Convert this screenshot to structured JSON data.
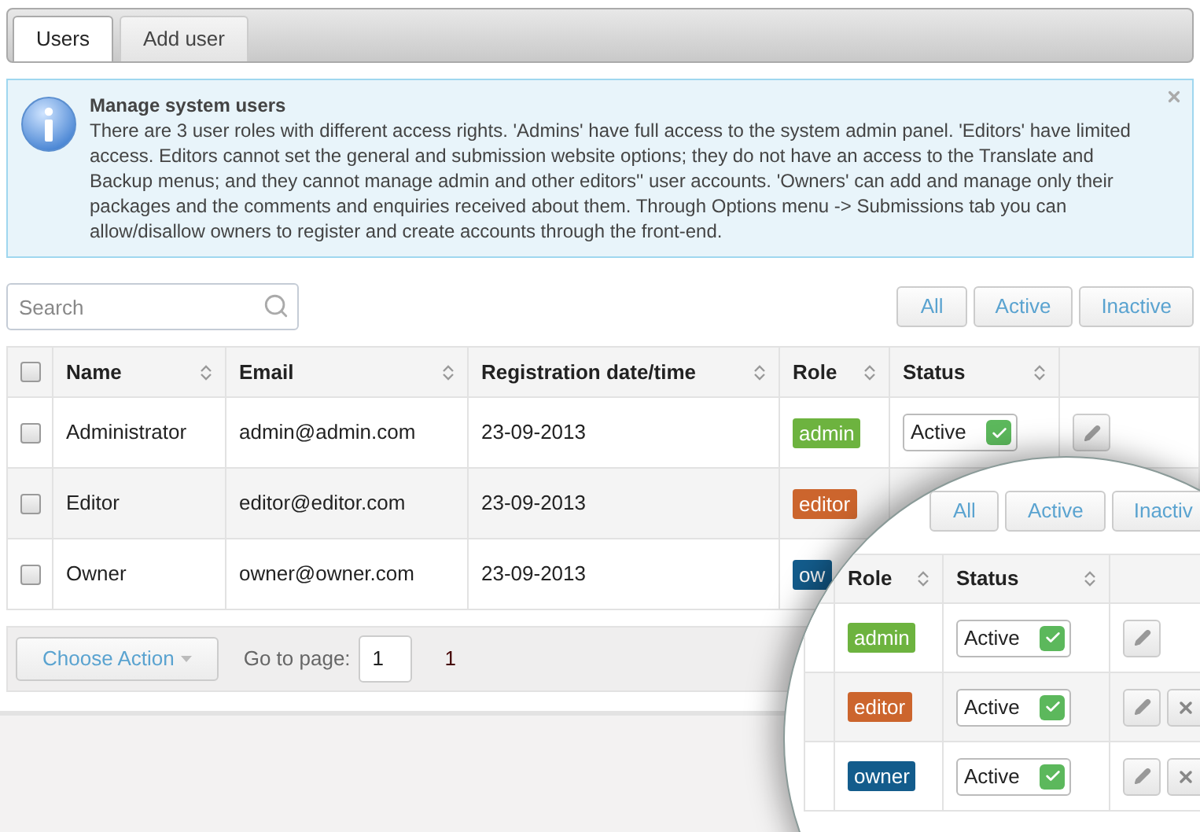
{
  "tabs": [
    {
      "label": "Users",
      "selected": true
    },
    {
      "label": "Add user",
      "selected": false
    }
  ],
  "notice": {
    "title": "Manage system users",
    "body": "There are 3 user roles with different access rights. 'Admins' have full access to the system admin panel. 'Editors' have limited access. Editors cannot set the general and submission website options; they do not have an access to the Translate and Backup menus; and they cannot manage admin and other editors'' user accounts. 'Owners' can add and manage only their packages and the comments and enquiries received about them. Through Options menu -> Submissions tab you can allow/disallow owners to register and create accounts through the front-end."
  },
  "search": {
    "placeholder": "Search"
  },
  "filters": [
    {
      "label": "All"
    },
    {
      "label": "Active"
    },
    {
      "label": "Inactive"
    }
  ],
  "table": {
    "select_all_checked": false,
    "columns": [
      "Name",
      "Email",
      "Registration date/time",
      "Role",
      "Status"
    ],
    "rows": [
      {
        "checked": false,
        "name": "Administrator",
        "email": "admin@admin.com",
        "date": "23-09-2013",
        "role": {
          "label": "admin",
          "color": "#6db33f"
        },
        "status": "Active",
        "actions": [
          {
            "kind": "edit"
          }
        ]
      },
      {
        "checked": false,
        "name": "Editor",
        "email": "editor@editor.com",
        "date": "23-09-2013",
        "role": {
          "label": "editor",
          "color": "#cc652d"
        }
      },
      {
        "checked": false,
        "name": "Owner",
        "email": "owner@owner.com",
        "date": "23-09-2013",
        "role": {
          "label": "ow",
          "color": "#135c8c"
        }
      }
    ]
  },
  "footer": {
    "bulk_action": "Choose Action",
    "go_to_label": "Go to page:",
    "go_to_value": "1",
    "current_page": "1"
  },
  "magnifier": {
    "filters": [
      {
        "label": "All"
      },
      {
        "label": "Active"
      },
      {
        "label": "Inactiv"
      }
    ],
    "columns": [
      "Role",
      "Status"
    ],
    "rows": [
      {
        "role": {
          "label": "admin",
          "color": "#6db33f"
        },
        "status": "Active",
        "actions": [
          {
            "kind": "edit"
          }
        ]
      },
      {
        "role": {
          "label": "editor",
          "color": "#cc652d"
        },
        "status": "Active",
        "actions": [
          {
            "kind": "edit"
          },
          {
            "kind": "delete"
          }
        ]
      },
      {
        "role": {
          "label": "owner",
          "color": "#135c8c"
        },
        "status": "Active",
        "actions": [
          {
            "kind": "edit"
          },
          {
            "kind": "delete"
          }
        ]
      }
    ]
  }
}
